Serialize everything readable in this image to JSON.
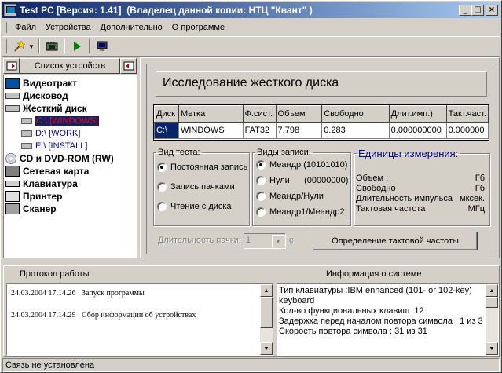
{
  "window": {
    "title": "Test PC [Версия: 1.41]  (Владелец данной копии: НТЦ \"Квант\" )",
    "controls": {
      "minimize": "_",
      "maximize": "□",
      "close": "×"
    }
  },
  "menu": [
    "Файл",
    "Устройства",
    "Дополнительно",
    "О программе"
  ],
  "toolbar": {
    "icons": [
      "wizard-icon",
      "dropdown-arrow-icon",
      "chip-icon",
      "play-icon",
      "monitor-icon"
    ]
  },
  "devices": {
    "header_label": "Список устройств",
    "items": [
      {
        "label": "Видеотракт",
        "icon": "monitor-icon"
      },
      {
        "label": "Дисковод",
        "icon": "floppy-icon"
      },
      {
        "label": "Жесткий диск",
        "icon": "hdd-icon"
      },
      {
        "label": "C:\\ [WINDOWS]",
        "icon": "partition-icon",
        "selected": true
      },
      {
        "label": "D:\\ [WORK]",
        "icon": "partition-icon"
      },
      {
        "label": "E:\\ [INSTALL]",
        "icon": "partition-icon"
      },
      {
        "label": "CD и DVD-ROM (RW)",
        "icon": "cd-icon"
      },
      {
        "label": "Сетевая карта",
        "icon": "network-icon"
      },
      {
        "label": "Клавиатура",
        "icon": "keyboard-icon"
      },
      {
        "label": "Принтер",
        "icon": "printer-icon"
      },
      {
        "label": "Сканер",
        "icon": "scanner-icon"
      }
    ]
  },
  "main": {
    "title": "Исследование жесткого диска",
    "table": {
      "headers": [
        "Диск",
        "Метка",
        "Ф.сист.",
        "Объем",
        "Свободно",
        "Длит.имп.)",
        "Такт.част."
      ],
      "rows": [
        [
          "C:\\",
          "WINDOWS",
          "FAT32",
          "7.798",
          "0.283",
          "0.000000000",
          "0.000000"
        ]
      ]
    },
    "test_type": {
      "legend": "Вид теста:",
      "options": [
        "Постоянная запись",
        "Запись пачками",
        "Чтение с диска"
      ],
      "selected": 0
    },
    "write_type": {
      "legend": "Виды записи:",
      "options": [
        "Меандр (10101010)",
        "Нули      (00000000)",
        "Меандр/Нули",
        "Меандр1/Меандр2"
      ],
      "selected": 0
    },
    "units": {
      "legend": "Единицы измерения:",
      "rows": [
        {
          "name": "Объем :",
          "unit": "Гб"
        },
        {
          "name": "Свободно",
          "unit": "Гб"
        },
        {
          "name": "Длительность импульса",
          "unit": "мксек."
        },
        {
          "name": "Тактовая частота",
          "unit": "МГц"
        }
      ]
    },
    "burst": {
      "label": "Длительность пачки:",
      "value": "1",
      "unit": "с"
    },
    "freq_button": "Определение тактовой частоты"
  },
  "log": {
    "title": "Протокол работы",
    "entries": [
      "24.03.2004 17.14.26   Запуск программы",
      "24.03.2004 17.14.29   Сбор информации об устройствах"
    ]
  },
  "sysinfo": {
    "title": "Информация о системе",
    "lines": [
      "Тип клавиатуры :IBM enhanced (101- or 102-key)",
      "keyboard",
      "Кол-во функциональных клавиш :12",
      "Задержка перед началом повтора символа : 1 из 3",
      "Скорость повтора символа : 31 из 31"
    ]
  },
  "status": "Связь не установлена"
}
